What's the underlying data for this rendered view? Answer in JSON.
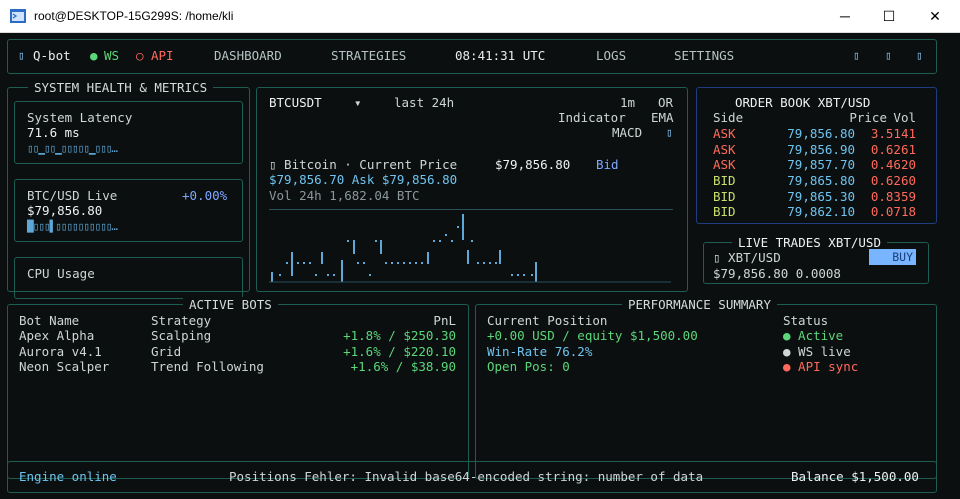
{
  "window": {
    "title": "root@DESKTOP-15G299S: /home/kli",
    "minimize": "─",
    "maximize": "☐",
    "close": "✕"
  },
  "topbar": {
    "brand": "Q-bot",
    "ws": "WS",
    "api": "API",
    "nav": [
      "DASHBOARD",
      "STRATEGIES"
    ],
    "clock": "08:41:31 UTC",
    "nav_right": [
      "LOGS",
      "SETTINGS"
    ],
    "ws_dot": "●",
    "api_dot": "○"
  },
  "health": {
    "title": "SYSTEM HEALTH & METRICS",
    "latency_label": "System Latency",
    "latency_value": "71.6 ms",
    "latency_spark": "▯▯▁▯▯▁▯▯▯▯▯▁▯▯▯…",
    "btc_label": "BTC/USD Live",
    "btc_change": "+0.00%",
    "btc_value": "$79,856.80",
    "btc_spark": "█▯▯▯▌▯▯▯▯▯▯▯▯▯▯…",
    "cpu_label": "CPU Usage"
  },
  "chart_panel": {
    "symbol": "BTCUSDT",
    "dropdown": "▾",
    "range": "last 24h",
    "interval": "1m",
    "or": "OR",
    "indicator": "Indicator",
    "ema": "EMA",
    "macd": "MACD",
    "icon": "▯",
    "coin": "▯ Bitcoin · Current Price",
    "price": "$79,856.80",
    "bid_label": "Bid",
    "bid_ask": "$79,856.70  Ask $79,856.80",
    "vol": "Vol 24h  1,682.04 BTC"
  },
  "orderbook": {
    "title": "ORDER BOOK  XBT/USD",
    "headers": [
      "Side",
      "Price",
      "Vol"
    ],
    "rows": [
      {
        "side": "ASK",
        "price": "79,856.80",
        "vol": "3.5141"
      },
      {
        "side": "ASK",
        "price": "79,856.90",
        "vol": "0.6261"
      },
      {
        "side": "ASK",
        "price": "79,857.70",
        "vol": "0.4620"
      },
      {
        "side": "BID",
        "price": "79,865.80",
        "vol": "0.6260"
      },
      {
        "side": "BID",
        "price": "79,865.30",
        "vol": "0.8359"
      },
      {
        "side": "BID",
        "price": "79,862.10",
        "vol": "0.0718"
      }
    ]
  },
  "trades": {
    "title": "LIVE TRADES  XBT/USD",
    "pair": "▯ XBT/USD",
    "buy": "BUY",
    "line": "$79,856.80  0.0008"
  },
  "bots": {
    "title": "ACTIVE BOTS",
    "headers": [
      "Bot Name",
      "Strategy",
      "PnL"
    ],
    "rows": [
      {
        "name": "Apex Alpha",
        "strategy": "Scalping",
        "pnl": "+1.8% / $250.30"
      },
      {
        "name": "Aurora v4.1",
        "strategy": "Grid",
        "pnl": "+1.6% / $220.10"
      },
      {
        "name": "Neon Scalper",
        "strategy": "Trend Following",
        "pnl": "+1.6% / $38.90"
      }
    ]
  },
  "performance": {
    "title": "PERFORMANCE SUMMARY",
    "position_label": "Current Position",
    "position_value": "+0.00 USD / equity $1,500.00",
    "winrate": "Win-Rate 76.2%",
    "open_pos": "Open Pos: 0",
    "status_label": "Status",
    "status": [
      {
        "text": "● Active",
        "color": "#5cd67a"
      },
      {
        "text": "● WS live",
        "color": "#cfd6d6"
      },
      {
        "text": "● API sync",
        "color": "#ff6a5c"
      }
    ]
  },
  "footer": {
    "engine": "Engine online",
    "message": "Positions Fehler: Invalid base64-encoded string: number of data",
    "balance": "Balance $1,500.00"
  },
  "colors": {
    "bg": "#0b0f10",
    "border": "#1f5c52",
    "cyan": "#6fc4ef",
    "green": "#5cd67a",
    "red": "#ff6a5c",
    "bid": "#c8e06a"
  }
}
